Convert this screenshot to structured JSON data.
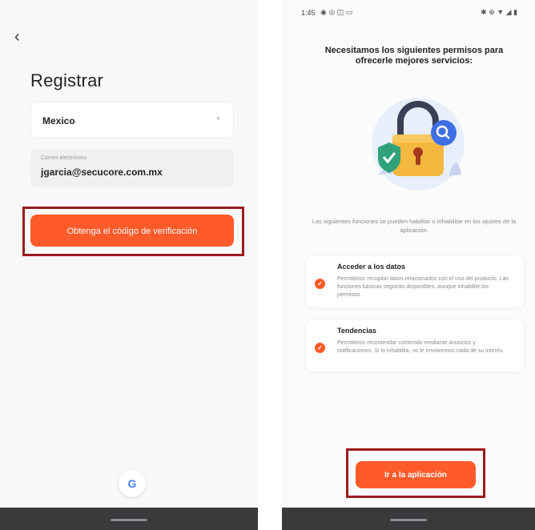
{
  "left": {
    "back_icon": "chevron-left-icon",
    "back_glyph": "‹",
    "title": "Registrar",
    "country": {
      "value": "Mexico",
      "chevron": "▾"
    },
    "email": {
      "label": "Correo electrónico",
      "value": "jgarcia@secucore.com.mx"
    },
    "verify_button": "Obtenga el código de verificación",
    "google_glyph": "G",
    "google_icon": "google-icon"
  },
  "right": {
    "status": {
      "time": "1:45",
      "left_icons": "◉ ◎ ◫ ▭",
      "right_icons": "✱ ⊕ ▼ ◢ ▮"
    },
    "title": "Necesitamos los siguientes permisos para ofrecerle mejores servicios:",
    "subtext": "Las siguientes funciones se pueden habilitar o inhabilitar en los ajustes de la aplicación.",
    "permissions": [
      {
        "title": "Acceder a los datos",
        "body": "Permitimos recopilar datos relacionados con el uso del producto. Las funciones básicas seguirán disponibles, aunque inhabilite los permisos."
      },
      {
        "title": "Tendencias",
        "body": "Permitimos recomendar contenido mediante anuncios y notificaciones. Si lo inhabilita, no le enviaremos nada de su interés."
      }
    ],
    "check_glyph": "✓",
    "go_button": "Ir a la aplicación"
  },
  "colors": {
    "accent": "#ff5a2a",
    "highlight": "#9b1b1e",
    "navbar": "#3a3a3d"
  }
}
